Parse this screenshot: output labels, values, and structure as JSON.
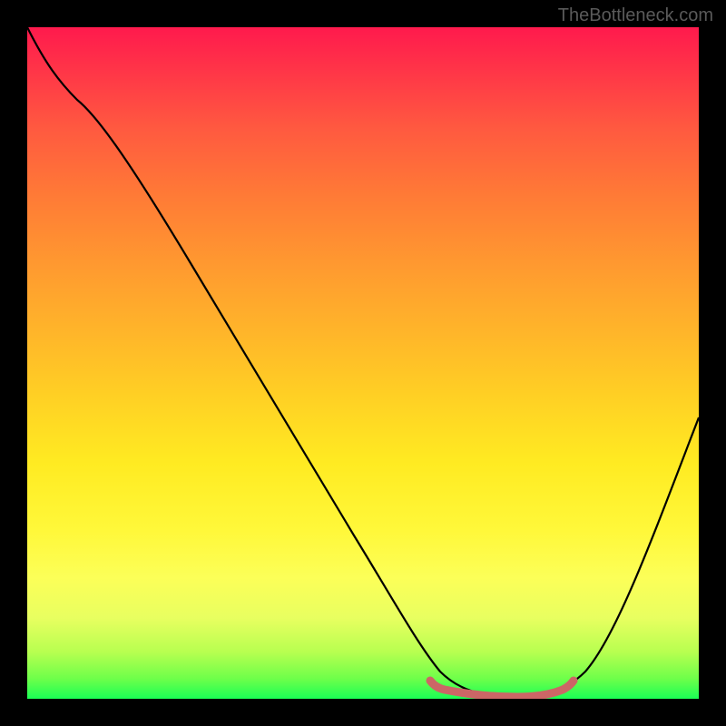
{
  "watermark": "TheBottleneck.com",
  "chart_data": {
    "type": "line",
    "title": "",
    "xlabel": "",
    "ylabel": "",
    "series": [
      {
        "name": "curve",
        "x": [
          0.0,
          0.05,
          0.1,
          0.2,
          0.3,
          0.4,
          0.5,
          0.55,
          0.6,
          0.65,
          0.7,
          0.75,
          0.8,
          0.85,
          0.9,
          0.95,
          1.0
        ],
        "y": [
          1.0,
          0.94,
          0.9,
          0.74,
          0.58,
          0.42,
          0.25,
          0.17,
          0.09,
          0.04,
          0.01,
          0.0,
          0.01,
          0.06,
          0.15,
          0.28,
          0.42
        ],
        "color": "#000000"
      },
      {
        "name": "trough-marker",
        "x": [
          0.6,
          0.63,
          0.66,
          0.69,
          0.72,
          0.75,
          0.78,
          0.81
        ],
        "y": [
          0.023,
          0.018,
          0.013,
          0.01,
          0.01,
          0.013,
          0.018,
          0.025
        ],
        "color": "#cc6666"
      }
    ],
    "xlim": [
      0,
      1
    ],
    "ylim": [
      0,
      1
    ],
    "background_gradient": {
      "top": "#ff1a4d",
      "bottom": "#1aff55"
    }
  }
}
